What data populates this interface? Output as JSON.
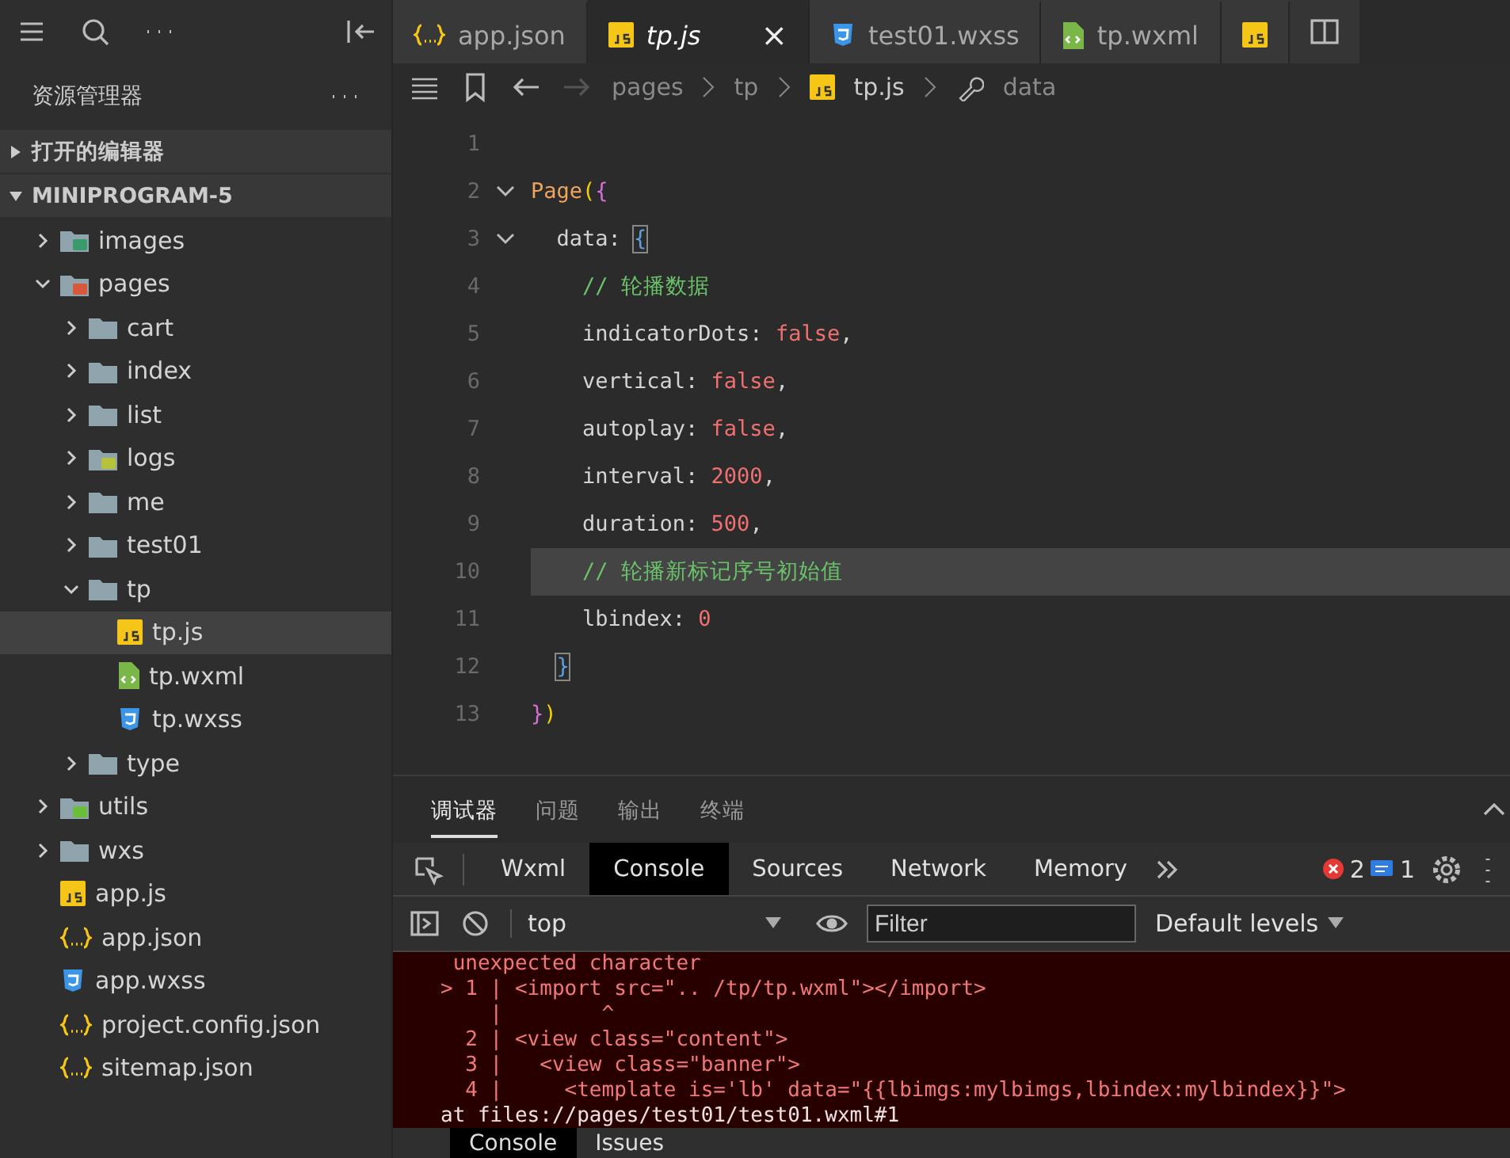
{
  "sidebar": {
    "title": "资源管理器",
    "sections": [
      {
        "label": "打开的编辑器",
        "expanded": false
      },
      {
        "label": "MINIPROGRAM-5",
        "expanded": true
      }
    ],
    "tree": [
      {
        "label": "images",
        "kind": "folder-images",
        "expanded": false,
        "selected": false
      },
      {
        "label": "pages",
        "kind": "folder-pages",
        "expanded": true,
        "selected": false,
        "children": [
          {
            "label": "cart",
            "kind": "folder",
            "expanded": false,
            "selected": false
          },
          {
            "label": "index",
            "kind": "folder",
            "expanded": false,
            "selected": false
          },
          {
            "label": "list",
            "kind": "folder",
            "expanded": false,
            "selected": false
          },
          {
            "label": "logs",
            "kind": "folder-logs",
            "expanded": false,
            "selected": false
          },
          {
            "label": "me",
            "kind": "folder",
            "expanded": false,
            "selected": false
          },
          {
            "label": "test01",
            "kind": "folder",
            "expanded": false,
            "selected": false
          },
          {
            "label": "tp",
            "kind": "folder",
            "expanded": true,
            "selected": false,
            "children": [
              {
                "label": "tp.js",
                "kind": "js",
                "selected": true
              },
              {
                "label": "tp.wxml",
                "kind": "wxml",
                "selected": false
              },
              {
                "label": "tp.wxss",
                "kind": "wxss",
                "selected": false
              }
            ]
          },
          {
            "label": "type",
            "kind": "folder",
            "expanded": false,
            "selected": false
          }
        ]
      },
      {
        "label": "utils",
        "kind": "folder-utils",
        "expanded": false,
        "selected": false
      },
      {
        "label": "wxs",
        "kind": "folder",
        "expanded": false,
        "selected": false
      },
      {
        "label": "app.js",
        "kind": "js",
        "selected": false
      },
      {
        "label": "app.json",
        "kind": "json",
        "selected": false
      },
      {
        "label": "app.wxss",
        "kind": "wxss",
        "selected": false
      },
      {
        "label": "project.config.json",
        "kind": "json",
        "selected": false
      },
      {
        "label": "sitemap.json",
        "kind": "json",
        "selected": false
      }
    ]
  },
  "editor_tabs": [
    {
      "label": "app.json",
      "kind": "json",
      "selected": false
    },
    {
      "label": "tp.js",
      "kind": "js",
      "selected": true,
      "close": "×"
    },
    {
      "label": "test01.wxss",
      "kind": "wxss",
      "selected": false
    },
    {
      "label": "tp.wxml",
      "kind": "wxml",
      "selected": false
    },
    {
      "kind": "js",
      "selected": false
    }
  ],
  "breadcrumb": [
    "pages",
    "tp",
    "tp.js",
    "data"
  ],
  "code": [
    {
      "number": "1",
      "fold": false,
      "highlighted": false
    },
    {
      "number": "2",
      "fold": true,
      "highlighted": false,
      "tokens": [
        {
          "text": "Page",
          "kind": "func"
        },
        {
          "text": "(",
          "kind": "paren"
        },
        {
          "text": "{",
          "kind": "brace"
        }
      ]
    },
    {
      "number": "3",
      "fold": true,
      "highlighted": false,
      "tokens": [
        {
          "text": "  data: ",
          "kind": "plain"
        },
        {
          "text": "{",
          "kind": "match"
        }
      ]
    },
    {
      "number": "4",
      "fold": false,
      "highlighted": false,
      "tokens": [
        {
          "text": "    // 轮播数据",
          "kind": "comment"
        }
      ]
    },
    {
      "number": "5",
      "fold": false,
      "highlighted": false,
      "tokens": [
        {
          "text": "    indicatorDots: ",
          "kind": "plain"
        },
        {
          "text": "false",
          "kind": "literal"
        },
        {
          "text": ",",
          "kind": "plain"
        }
      ]
    },
    {
      "number": "6",
      "fold": false,
      "highlighted": false,
      "tokens": [
        {
          "text": "    vertical: ",
          "kind": "plain"
        },
        {
          "text": "false",
          "kind": "literal"
        },
        {
          "text": ",",
          "kind": "plain"
        }
      ]
    },
    {
      "number": "7",
      "fold": false,
      "highlighted": false,
      "tokens": [
        {
          "text": "    autoplay: ",
          "kind": "plain"
        },
        {
          "text": "false",
          "kind": "literal"
        },
        {
          "text": ",",
          "kind": "plain"
        }
      ]
    },
    {
      "number": "8",
      "fold": false,
      "highlighted": false,
      "tokens": [
        {
          "text": "    interval: ",
          "kind": "plain"
        },
        {
          "text": "2000",
          "kind": "literal"
        },
        {
          "text": ",",
          "kind": "plain"
        }
      ]
    },
    {
      "number": "9",
      "fold": false,
      "highlighted": false,
      "tokens": [
        {
          "text": "    duration: ",
          "kind": "plain"
        },
        {
          "text": "500",
          "kind": "literal"
        },
        {
          "text": ",",
          "kind": "plain"
        }
      ]
    },
    {
      "number": "10",
      "fold": false,
      "highlighted": true,
      "tokens": [
        {
          "text": "    // 轮播新标记序号初始值",
          "kind": "comment"
        }
      ]
    },
    {
      "number": "11",
      "fold": false,
      "highlighted": false,
      "tokens": [
        {
          "text": "    lbindex: ",
          "kind": "plain"
        },
        {
          "text": "0",
          "kind": "literal"
        }
      ]
    },
    {
      "number": "12",
      "fold": false,
      "highlighted": false,
      "tokens": [
        {
          "text": "}",
          "kind": "match-indented"
        }
      ]
    },
    {
      "number": "13",
      "fold": false,
      "highlighted": false,
      "tokens": [
        {
          "text": "}",
          "kind": "brace"
        },
        {
          "text": ")",
          "kind": "paren"
        }
      ]
    }
  ],
  "panel_tabs": [
    {
      "label": "调试器",
      "selected": true
    },
    {
      "label": "问题",
      "selected": false
    },
    {
      "label": "输出",
      "selected": false
    },
    {
      "label": "终端",
      "selected": false
    }
  ],
  "devtools_tabs": [
    {
      "label": "Wxml",
      "selected": false
    },
    {
      "label": "Console",
      "selected": true
    },
    {
      "label": "Sources",
      "selected": false
    },
    {
      "label": "Network",
      "selected": false
    },
    {
      "label": "Memory",
      "selected": false
    }
  ],
  "error_count": "2",
  "message_count": "1",
  "console_toolbar": {
    "context": "top",
    "filter_placeholder": "Filter",
    "levels": "Default levels"
  },
  "console_lines": [
    {
      "kind": "error",
      "text": " unexpected character"
    },
    {
      "kind": "error",
      "text": "> 1 | <import src=\".. /tp/tp.wxml\"></import>"
    },
    {
      "kind": "error",
      "text": "    |        ^"
    },
    {
      "kind": "error",
      "text": "  2 | <view class=\"content\">"
    },
    {
      "kind": "error",
      "text": "  3 |   <view class=\"banner\">"
    },
    {
      "kind": "error",
      "text": "  4 |     <template is='lb' data=\"{{lbimgs:mylbimgs,lbindex:mylbindex}}\">"
    },
    {
      "kind": "location",
      "text": "at files://pages/test01/test01.wxml#1"
    }
  ],
  "bottom_tabs": [
    {
      "label": "Console",
      "selected": true
    },
    {
      "label": "Issues",
      "selected": false
    }
  ]
}
